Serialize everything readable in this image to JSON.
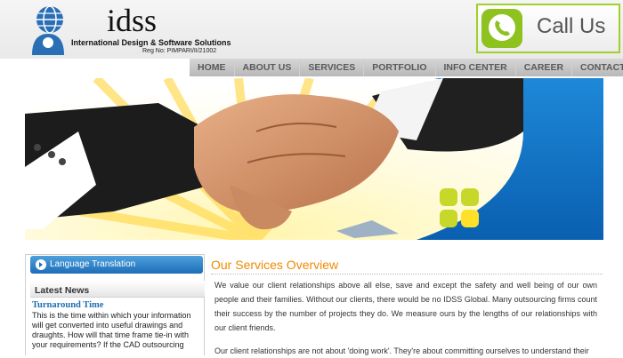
{
  "header": {
    "brand": "idss",
    "tagline": "International Design & Software Solutions",
    "reg_no": "Reg No: PIMPARI/II/21002",
    "call_us": "Call Us"
  },
  "nav": {
    "items": [
      "HOME",
      "ABOUT US",
      "SERVICES",
      "PORTFOLIO",
      "INFO CENTER",
      "CAREER",
      "CONTACT US"
    ]
  },
  "sidebar": {
    "language_translation": "Language Translation",
    "latest_news_title": "Latest News",
    "news_item_title": "Turnaround Time",
    "news_item_body": "This is the time within which your information will get converted into useful drawings and draughts. How will that time frame tie-in with your requirements? If the CAD outsourcing"
  },
  "main": {
    "title": "Our Services Overview",
    "paragraph1": "We value our client relationships above all else, save and except the safety and well being of our own people and their families. Without our clients, there would be no IDSS Global. Many outsourcing firms count their success by the number of projects they do. We measure ours by the lengths of our relationships with our client friends.",
    "paragraph2": "Our client relationships are not about 'doing work'. They're about committing ourselves to understand their"
  },
  "colors": {
    "accent_orange": "#f08a00",
    "call_green": "#8dc21f",
    "link_blue": "#1f6fb2",
    "bar_blue": "#1d6eb8"
  },
  "icons": [
    "globe-logo-icon",
    "phone-icon",
    "arrow-right-icon"
  ]
}
